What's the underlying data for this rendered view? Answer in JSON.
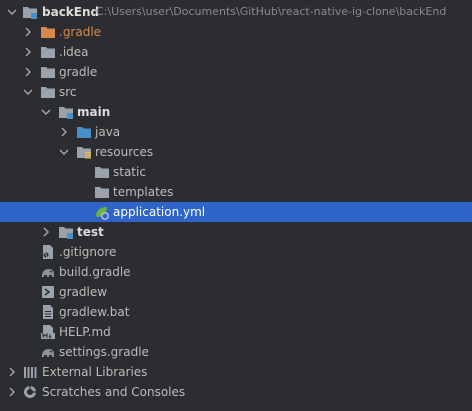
{
  "tree": {
    "root": {
      "label": "backEnd",
      "path": "C:\\Users\\user\\Documents\\GitHub\\react-native-ig-clone\\backEnd"
    },
    "items": [
      {
        "label": ".gradle"
      },
      {
        "label": ".idea"
      },
      {
        "label": "gradle"
      },
      {
        "label": "src"
      },
      {
        "label": "main"
      },
      {
        "label": "java"
      },
      {
        "label": "resources"
      },
      {
        "label": "static"
      },
      {
        "label": "templates"
      },
      {
        "label": "application.yml"
      },
      {
        "label": "test"
      },
      {
        "label": ".gitignore"
      },
      {
        "label": "build.gradle"
      },
      {
        "label": "gradlew"
      },
      {
        "label": "gradlew.bat"
      },
      {
        "label": "HELP.md"
      },
      {
        "label": "settings.gradle"
      },
      {
        "label": "External Libraries"
      },
      {
        "label": "Scratches and Consoles"
      }
    ]
  },
  "colors": {
    "background": "#2b2d30",
    "selection": "#2f65ca",
    "folder": "#9aa2ab",
    "excluded_folder": "#d7894b",
    "source_folder": "#4a90c8"
  },
  "icons": {
    "folder": "folder-icon",
    "module": "module-folder-icon",
    "gradle": "gradle-elephant-icon",
    "yaml": "spring-yaml-icon",
    "gitignore": "gitignore-icon",
    "script": "script-icon",
    "markdown": "markdown-icon",
    "libraries": "libraries-icon",
    "scratches": "scratches-icon"
  }
}
